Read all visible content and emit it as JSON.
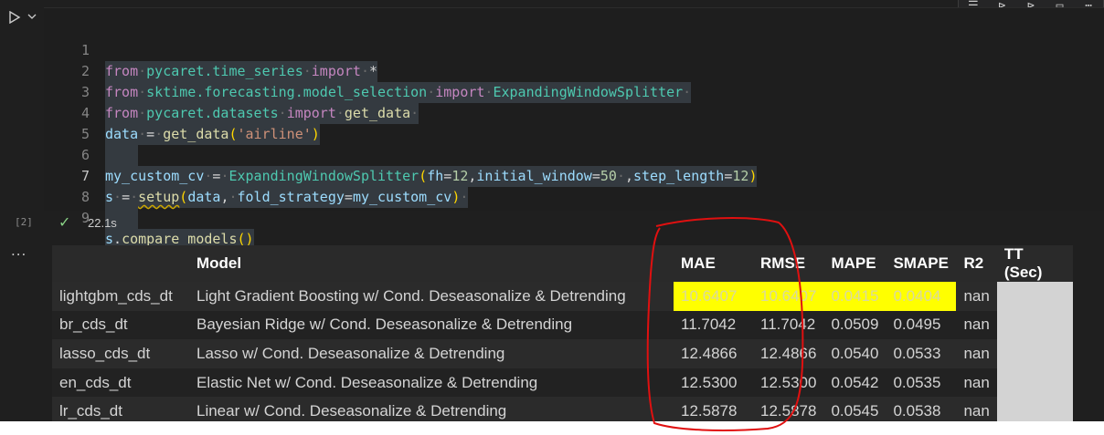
{
  "code": {
    "lines": [
      {
        "n": "1"
      },
      {
        "n": "2"
      },
      {
        "n": "3"
      },
      {
        "n": "4"
      },
      {
        "n": "5"
      },
      {
        "n": "6"
      },
      {
        "n": "7"
      },
      {
        "n": "8"
      },
      {
        "n": "9"
      }
    ],
    "l1": {
      "from": "from",
      "mod": "pycaret.time_series",
      "import": "import",
      "star": "*"
    },
    "l2": {
      "from": "from",
      "mod": "sktime.forecasting.model_selection",
      "import": "import",
      "name": "ExpandingWindowSplitter"
    },
    "l3": {
      "from": "from",
      "mod": "pycaret.datasets",
      "import": "import",
      "name": "get_data"
    },
    "l4": {
      "var": "data",
      "eq": "=",
      "fn": "get_data",
      "arg": "'airline'"
    },
    "l6": {
      "var": "my_custom_cv",
      "eq": "=",
      "fn": "ExpandingWindowSplitter",
      "p1": "fh",
      "v1": "12",
      "p2": "initial_window",
      "v2": "50",
      "p3": "step_length",
      "v3": "12"
    },
    "l7": {
      "var": "s",
      "eq": "=",
      "fn": "setup",
      "a1": "data",
      "p1": "fold_strategy",
      "v1": "my_custom_cv"
    },
    "l9": {
      "obj": "s",
      "fn": "compare_models"
    }
  },
  "status": {
    "exec_count": "[2]",
    "duration": "22.1s",
    "more": "...",
    "check_icon": "check-icon"
  },
  "table": {
    "headers": [
      "",
      "Model",
      "MAE",
      "RMSE",
      "MAPE",
      "SMAPE",
      "R2",
      "TT (Sec)"
    ],
    "rows": [
      {
        "id": "lightgbm_cds_dt",
        "model": "Light Gradient Boosting w/ Cond. Deseasonalize & Detrending",
        "mae": "10.6407",
        "rmse": "10.6407",
        "mape": "0.0415",
        "smape": "0.0404",
        "r2": "nan",
        "tt": ""
      },
      {
        "id": "br_cds_dt",
        "model": "Bayesian Ridge w/ Cond. Deseasonalize & Detrending",
        "mae": "11.7042",
        "rmse": "11.7042",
        "mape": "0.0509",
        "smape": "0.0495",
        "r2": "nan",
        "tt": ""
      },
      {
        "id": "lasso_cds_dt",
        "model": "Lasso w/ Cond. Deseasonalize & Detrending",
        "mae": "12.4866",
        "rmse": "12.4866",
        "mape": "0.0540",
        "smape": "0.0533",
        "r2": "nan",
        "tt": ""
      },
      {
        "id": "en_cds_dt",
        "model": "Elastic Net w/ Cond. Deseasonalize & Detrending",
        "mae": "12.5300",
        "rmse": "12.5300",
        "mape": "0.0542",
        "smape": "0.0535",
        "r2": "nan",
        "tt": ""
      },
      {
        "id": "lr_cds_dt",
        "model": "Linear w/ Cond. Deseasonalize & Detrending",
        "mae": "12.5878",
        "rmse": "12.5878",
        "mape": "0.0545",
        "smape": "0.0538",
        "r2": "nan",
        "tt": ""
      }
    ]
  },
  "colors": {
    "highlight": "#ffff00",
    "tt_cell": "#d3d3d3",
    "annotation": "#e01010"
  }
}
